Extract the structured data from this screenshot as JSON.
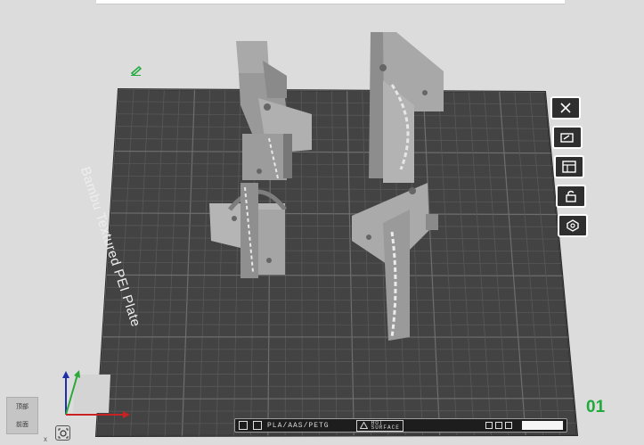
{
  "plate": {
    "label": "Bambu Textured PEI Plate",
    "number": "01",
    "filament_type": "PLA/AAS/PETG",
    "hot_surface_line1": "HOT",
    "hot_surface_line2": "SURFACE"
  },
  "view_cube": {
    "top_face": "顶部",
    "front_face": "前面"
  },
  "axes": {
    "x_label": "x"
  },
  "toolbar": {
    "items": [
      "close-icon",
      "arrange-icon",
      "layout-icon",
      "lock-icon",
      "settings-icon"
    ]
  },
  "colors": {
    "plate": "#434343",
    "grid": "#5c5c5c",
    "model": "#9a9a9a",
    "background": "#dcdcdc",
    "accent": "#1faa3b"
  }
}
